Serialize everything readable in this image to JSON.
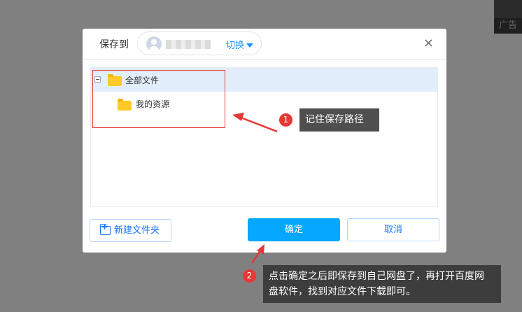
{
  "ad": {
    "label": "广告"
  },
  "dialog": {
    "title": "保存到",
    "account_switch": "切换",
    "close_symbol": "×",
    "tree": {
      "root": "全部文件",
      "children": [
        "我的资源"
      ]
    },
    "buttons": {
      "new_folder": "新建文件夹",
      "confirm": "确定",
      "cancel": "取消"
    }
  },
  "annotations": [
    {
      "number": "1",
      "text": "记住保存路径"
    },
    {
      "number": "2",
      "line1": "点击确定之后即保存到自己网盘了，再打开百度网",
      "line2": "盘软件，找到对应文件下载即可。"
    }
  ],
  "colors": {
    "accent": "#06a7ff",
    "link": "#1677ff",
    "annotation_red": "#e53935",
    "overlay": "#808080"
  }
}
